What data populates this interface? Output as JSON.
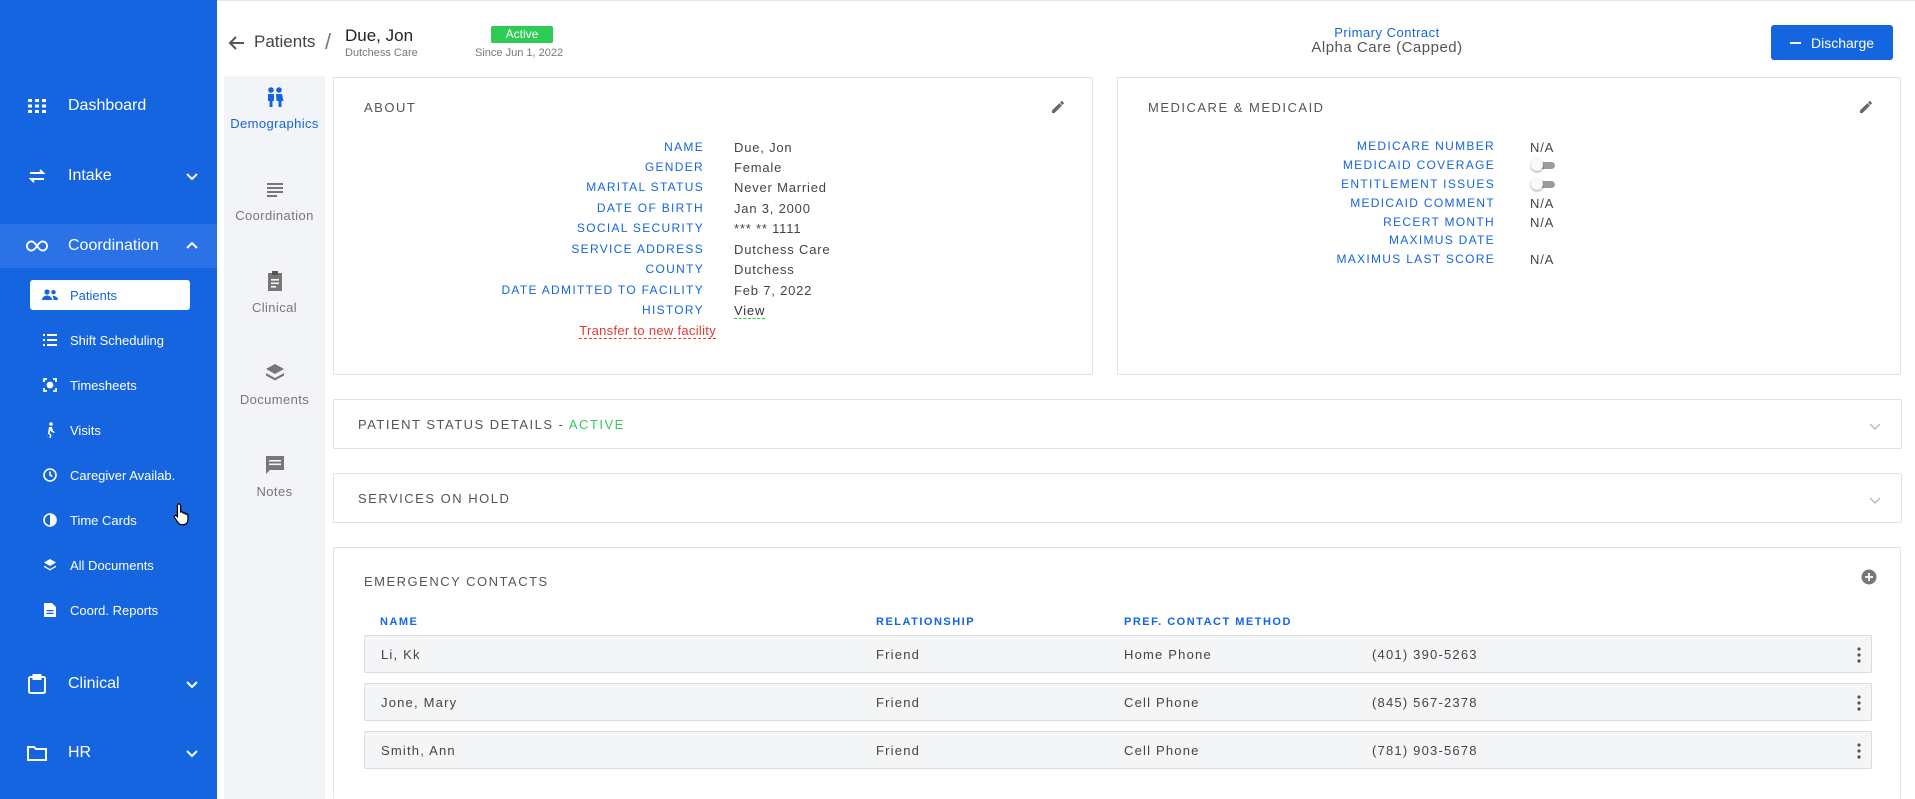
{
  "sidebar": {
    "items": [
      {
        "label": "Dashboard",
        "icon": "grid-icon"
      },
      {
        "label": "Intake",
        "icon": "swap-icon"
      },
      {
        "label": "Coordination",
        "icon": "infinity-icon"
      },
      {
        "label": "Clinical",
        "icon": "clipboard-icon"
      },
      {
        "label": "HR",
        "icon": "folder-icon"
      }
    ],
    "sub_items": [
      {
        "label": "Patients",
        "icon": "people-icon"
      },
      {
        "label": "Shift Scheduling",
        "icon": "list-icon"
      },
      {
        "label": "Timesheets",
        "icon": "scan-icon"
      },
      {
        "label": "Visits",
        "icon": "walk-icon"
      },
      {
        "label": "Caregiver Availab.",
        "icon": "clock-icon"
      },
      {
        "label": "Time Cards",
        "icon": "pie-icon"
      },
      {
        "label": "All Documents",
        "icon": "layers-icon"
      },
      {
        "label": "Coord. Reports",
        "icon": "report-icon"
      }
    ]
  },
  "header": {
    "breadcrumb": "Patients",
    "patient_name": "Due, Jon",
    "patient_facility": "Dutchess Care",
    "status_badge": "Active",
    "since": "Since Jun 1, 2022",
    "primary_contract_label": "Primary Contract",
    "primary_contract_value": "Alpha Care (Capped)",
    "discharge_label": "Discharge"
  },
  "subnav": [
    {
      "label": "Demographics",
      "icon": "people-icon"
    },
    {
      "label": "Coordination",
      "icon": "lines-icon"
    },
    {
      "label": "Clinical",
      "icon": "clipboard-icon"
    },
    {
      "label": "Documents",
      "icon": "layers-icon"
    },
    {
      "label": "Notes",
      "icon": "note-icon"
    }
  ],
  "about": {
    "title": "ABOUT",
    "fields": [
      {
        "label": "NAME",
        "value": "Due, Jon"
      },
      {
        "label": "GENDER",
        "value": "Female"
      },
      {
        "label": "MARITAL STATUS",
        "value": "Never Married"
      },
      {
        "label": "DATE OF BIRTH",
        "value": "Jan 3, 2000"
      },
      {
        "label": "SOCIAL SECURITY",
        "value": "*** ** 1111"
      },
      {
        "label": "SERVICE ADDRESS",
        "value": "Dutchess Care"
      },
      {
        "label": "COUNTY",
        "value": "Dutchess"
      },
      {
        "label": "DATE ADMITTED TO FACILITY",
        "value": "Feb 7, 2022"
      },
      {
        "label": "HISTORY",
        "value": "View"
      }
    ],
    "transfer_link": "Transfer to new facility"
  },
  "medicare": {
    "title": "MEDICARE & MEDICAID",
    "fields": [
      {
        "label": "MEDICARE NUMBER",
        "value": "N/A"
      },
      {
        "label": "MEDICAID COVERAGE",
        "value": ""
      },
      {
        "label": "ENTITLEMENT ISSUES",
        "value": ""
      },
      {
        "label": "MEDICAID COMMENT",
        "value": "N/A"
      },
      {
        "label": "RECERT MONTH",
        "value": "N/A"
      },
      {
        "label": "MAXIMUS DATE",
        "value": ""
      },
      {
        "label": "MAXIMUS LAST SCORE",
        "value": "N/A"
      }
    ]
  },
  "status_details": {
    "title": "PATIENT STATUS DETAILS - ",
    "status": "ACTIVE"
  },
  "services_on_hold": {
    "title": "SERVICES ON HOLD"
  },
  "emergency_contacts": {
    "title": "EMERGENCY CONTACTS",
    "columns": [
      "NAME",
      "RELATIONSHIP",
      "PREF. CONTACT METHOD"
    ],
    "rows": [
      {
        "name": "Li, Kk",
        "relationship": "Friend",
        "method": "Home Phone",
        "phone": "(401) 390-5263"
      },
      {
        "name": "Jone, Mary",
        "relationship": "Friend",
        "method": "Cell Phone",
        "phone": "(845) 567-2378"
      },
      {
        "name": "Smith, Ann",
        "relationship": "Friend",
        "method": "Cell Phone",
        "phone": "(781) 903-5678"
      }
    ]
  },
  "colors": {
    "accent": "#1565e0",
    "active_green": "#2ecc55",
    "danger": "#e53935"
  }
}
